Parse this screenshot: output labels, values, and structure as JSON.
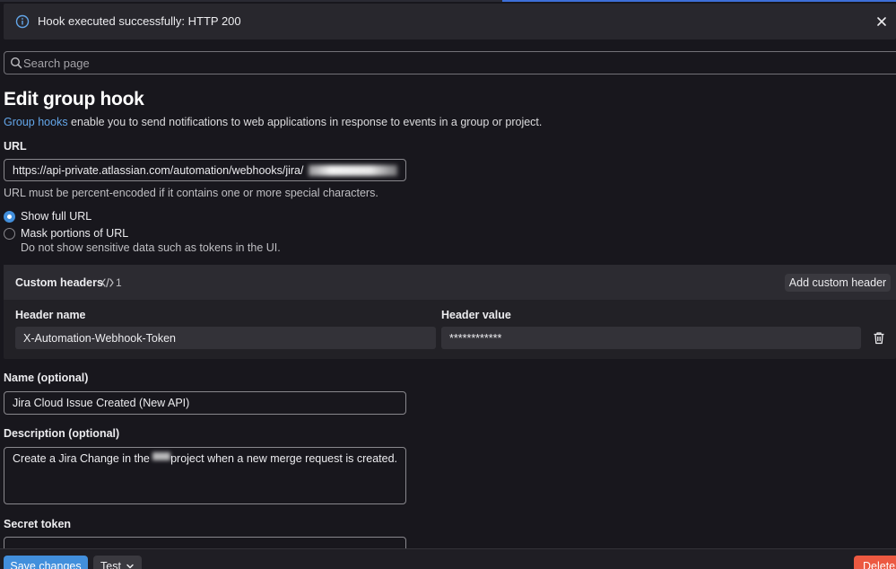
{
  "alert": {
    "message": "Hook executed successfully: HTTP 200",
    "icon": "info-icon",
    "accent_color": "#63a6e9"
  },
  "search": {
    "placeholder": "Search page"
  },
  "page": {
    "title": "Edit group hook",
    "intro_link": "Group hooks",
    "intro_rest": " enable you to send notifications to web applications in response to events in a group or project."
  },
  "url": {
    "label": "URL",
    "value": "https://api-private.atlassian.com/automation/webhooks/jira/",
    "help": "URL must be percent-encoded if it contains one or more special characters.",
    "options": [
      {
        "label": "Show full URL",
        "selected": true
      },
      {
        "label": "Mask portions of URL",
        "selected": false
      }
    ],
    "mask_help": "Do not show sensitive data such as tokens in the UI."
  },
  "custom_headers": {
    "title": "Custom headers",
    "count": "1",
    "add_label": "Add custom header",
    "col_name": "Header name",
    "col_value": "Header value",
    "rows": [
      {
        "name": "X-Automation-Webhook-Token",
        "value": "************"
      }
    ]
  },
  "name_field": {
    "label": "Name (optional)",
    "value": "Jira Cloud Issue Created (New API)"
  },
  "description_field": {
    "label": "Description (optional)",
    "value_before": "Create a Jira Change in the",
    "value_after": " project when a new merge request is created."
  },
  "secret_token": {
    "label": "Secret token"
  },
  "footer": {
    "save_label": "Save changes",
    "test_label": "Test",
    "delete_label": "Delete"
  },
  "colors": {
    "background": "#18171d",
    "primary": "#428fdc",
    "danger": "#ec5941",
    "link": "#63a6e9"
  }
}
